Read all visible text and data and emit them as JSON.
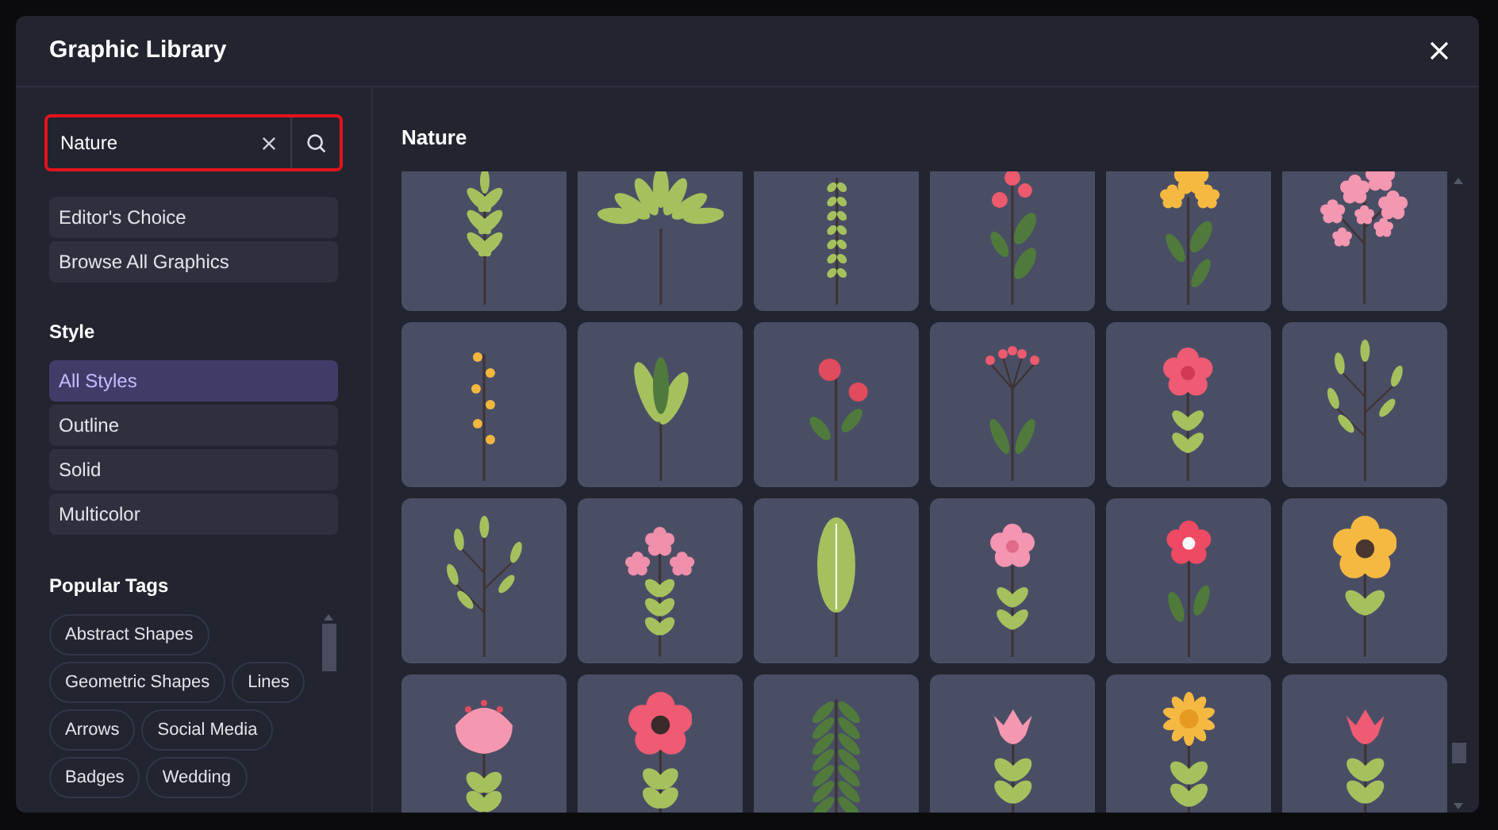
{
  "window": {
    "title": "Graphic Library"
  },
  "search": {
    "value": "Nature"
  },
  "collections": [
    {
      "label": "Editor's Choice"
    },
    {
      "label": "Browse All Graphics"
    }
  ],
  "style": {
    "heading": "Style",
    "options": [
      {
        "label": "All Styles",
        "selected": true
      },
      {
        "label": "Outline",
        "selected": false
      },
      {
        "label": "Solid",
        "selected": false
      },
      {
        "label": "Multicolor",
        "selected": false
      }
    ]
  },
  "popular_tags": {
    "heading": "Popular Tags",
    "tags": [
      [
        "Abstract Shapes"
      ],
      [
        "Geometric Shapes",
        "Lines"
      ],
      [
        "Arrows",
        "Social Media"
      ],
      [
        "Badges",
        "Wedding"
      ]
    ]
  },
  "results": {
    "heading": "Nature",
    "graphics": [
      {
        "kind": "sprig"
      },
      {
        "kind": "palm"
      },
      {
        "kind": "fern"
      },
      {
        "kind": "red-berries"
      },
      {
        "kind": "yellow-flowers"
      },
      {
        "kind": "pink-blossoms"
      },
      {
        "kind": "yellow-berries"
      },
      {
        "kind": "leaves"
      },
      {
        "kind": "rosehip"
      },
      {
        "kind": "berry-umbel"
      },
      {
        "kind": "pink-flower"
      },
      {
        "kind": "twig"
      },
      {
        "kind": "twig"
      },
      {
        "kind": "pink-buds"
      },
      {
        "kind": "leaf"
      },
      {
        "kind": "pink-star"
      },
      {
        "kind": "red-star"
      },
      {
        "kind": "yellow-lily"
      },
      {
        "kind": "pink-bloom"
      },
      {
        "kind": "red-flower"
      },
      {
        "kind": "fern-frond"
      },
      {
        "kind": "tulip"
      },
      {
        "kind": "daisy"
      },
      {
        "kind": "red-tulip"
      }
    ]
  }
}
